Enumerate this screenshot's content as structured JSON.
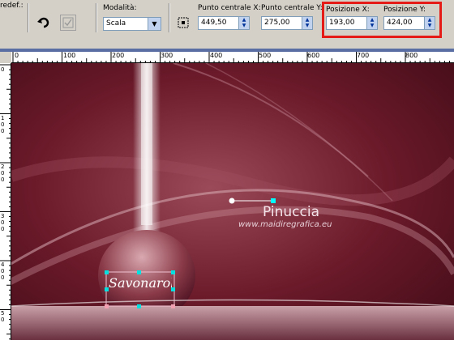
{
  "toolbar": {
    "preset_label": "redef.:",
    "mode_label": "Modalità:",
    "mode_value": "Scala",
    "center_x_label": "Punto centrale X:",
    "center_x_value": "449,50",
    "center_y_label": "Punto centrale Y:",
    "center_y_value": "275,00",
    "pos_x_label": "Posizione X:",
    "pos_x_value": "193,00",
    "pos_y_label": "Posizione Y:",
    "pos_y_value": "424,00"
  },
  "ruler": {
    "h_labels": [
      "0",
      "100",
      "200",
      "300",
      "400",
      "500",
      "600",
      "700",
      "800"
    ],
    "v_labels": [
      "0",
      "1\n0\n0",
      "2\n0\n0",
      "3\n0\n0",
      "4\n0\n0",
      "5\n0"
    ]
  },
  "canvas": {
    "watermark_name": "Pinuccia",
    "watermark_url": "www.maidiregrafica.eu",
    "selected_text": "Savonarola"
  },
  "colors": {
    "highlight": "#e41b17",
    "canvas_bg": "#6b1a2a"
  }
}
